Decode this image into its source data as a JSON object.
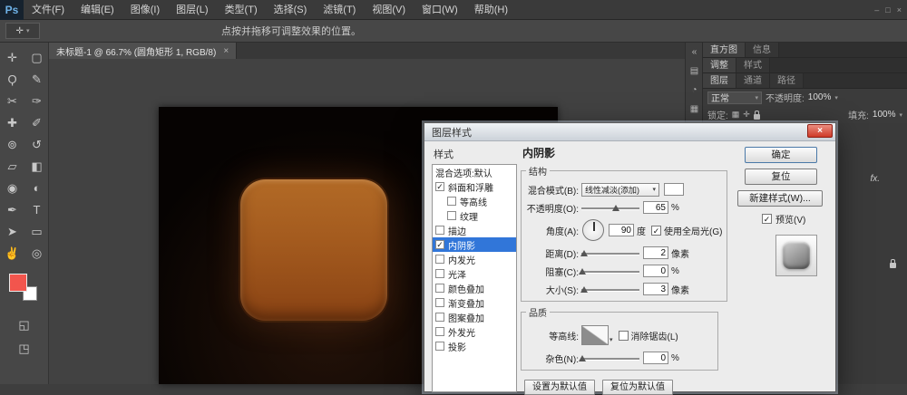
{
  "colors": {
    "accent_blue": "#3176d9",
    "button_orange": "#a85a20",
    "foreground_red": "#f2554d",
    "close_red": "#cf3a28"
  },
  "icons": {
    "caret_down": "▾"
  },
  "menubar": {
    "logo": "Ps",
    "items": [
      "文件(F)",
      "编辑(E)",
      "图像(I)",
      "图层(L)",
      "类型(T)",
      "选择(S)",
      "滤镜(T)",
      "视图(V)",
      "窗口(W)",
      "帮助(H)"
    ],
    "window_controls": [
      "–",
      "□",
      "×"
    ]
  },
  "options_bar": {
    "tool_icon": "✛",
    "hint": "点按并拖移可调整效果的位置。"
  },
  "document_tab": {
    "title": "未标题-1 @ 66.7% (圆角矩形 1, RGB/8)",
    "close": "×"
  },
  "toolbar": {
    "tools": [
      {
        "name": "move-tool",
        "glyph": "✛"
      },
      {
        "name": "rectangular-marquee-tool",
        "glyph": "▢"
      },
      {
        "name": "lasso-tool",
        "glyph": "Ϙ"
      },
      {
        "name": "quick-selection-tool",
        "glyph": "✎"
      },
      {
        "name": "crop-tool",
        "glyph": "✂"
      },
      {
        "name": "eyedropper-tool",
        "glyph": "✑"
      },
      {
        "name": "healing-brush-tool",
        "glyph": "✚"
      },
      {
        "name": "brush-tool",
        "glyph": "✐"
      },
      {
        "name": "clone-stamp-tool",
        "glyph": "⊚"
      },
      {
        "name": "history-brush-tool",
        "glyph": "↺"
      },
      {
        "name": "eraser-tool",
        "glyph": "▱"
      },
      {
        "name": "gradient-tool",
        "glyph": "◧"
      },
      {
        "name": "blur-tool",
        "glyph": "◉"
      },
      {
        "name": "dodge-tool",
        "glyph": "◐"
      },
      {
        "name": "pen-tool",
        "glyph": "✒"
      },
      {
        "name": "type-tool",
        "glyph": "T"
      },
      {
        "name": "path-selection-tool",
        "glyph": "➤"
      },
      {
        "name": "rectangle-tool",
        "glyph": "▭"
      },
      {
        "name": "hand-tool",
        "glyph": "✌"
      },
      {
        "name": "zoom-tool",
        "glyph": "◎"
      }
    ],
    "extra": [
      {
        "name": "quick-mask-mode",
        "glyph": "◱"
      },
      {
        "name": "screen-mode",
        "glyph": "◳"
      }
    ]
  },
  "right_dock": {
    "icons": [
      "«",
      "▤",
      "◔",
      "▦",
      "✦",
      "▣"
    ]
  },
  "right_panels": {
    "tabs_row1": [
      "直方图",
      "信息"
    ],
    "tabs_row2": [
      "调整",
      "样式"
    ],
    "tabs_row3": [
      "图层",
      "通道",
      "路径"
    ],
    "blend_mode": "正常",
    "opacity_label": "不透明度:",
    "opacity_value": "100%",
    "lock_label": "锁定:",
    "lock_icons": [
      "▦",
      "✛"
    ],
    "fill_label": "填充:",
    "fill_value": "100%",
    "fx_badge": "fx."
  },
  "dialog": {
    "title": "图层样式",
    "close_glyph": "×",
    "styles_panel": {
      "header": "样式",
      "items": [
        {
          "label": "混合选项:默认",
          "check": ""
        },
        {
          "label": "斜面和浮雕",
          "check": "✓"
        },
        {
          "label": "等高线",
          "check": ""
        },
        {
          "label": "纹理",
          "check": ""
        },
        {
          "label": "描边",
          "check": ""
        },
        {
          "label": "内阴影",
          "check": "✓"
        },
        {
          "label": "内发光",
          "check": ""
        },
        {
          "label": "光泽",
          "check": ""
        },
        {
          "label": "颜色叠加",
          "check": ""
        },
        {
          "label": "渐变叠加",
          "check": ""
        },
        {
          "label": "图案叠加",
          "check": ""
        },
        {
          "label": "外发光",
          "check": ""
        },
        {
          "label": "投影",
          "check": ""
        }
      ]
    },
    "main": {
      "header": "内阴影",
      "structure_group": "结构",
      "blend_mode_label": "混合模式(B):",
      "blend_mode_value": "线性减淡(添加)",
      "opacity_label": "不透明度(O):",
      "opacity_value": "65",
      "opacity_unit": "%",
      "angle_label": "角度(A):",
      "angle_value": "90",
      "angle_unit": "度",
      "global_light_check": "✓",
      "global_light_label": "使用全局光(G)",
      "distance_label": "距离(D):",
      "distance_value": "2",
      "distance_unit": "像素",
      "choke_label": "阻塞(C):",
      "choke_value": "0",
      "choke_unit": "%",
      "size_label": "大小(S):",
      "size_value": "3",
      "size_unit": "像素",
      "quality_group": "品质",
      "contour_label": "等高线:",
      "antialias_check": "",
      "antialias_label": "消除锯齿(L)",
      "noise_label": "杂色(N):",
      "noise_value": "0",
      "noise_unit": "%",
      "set_default": "设置为默认值",
      "reset_default": "复位为默认值"
    },
    "buttons": {
      "ok": "确定",
      "reset": "复位",
      "new_style": "新建样式(W)...",
      "preview_check": "✓",
      "preview_label": "预览(V)"
    }
  }
}
